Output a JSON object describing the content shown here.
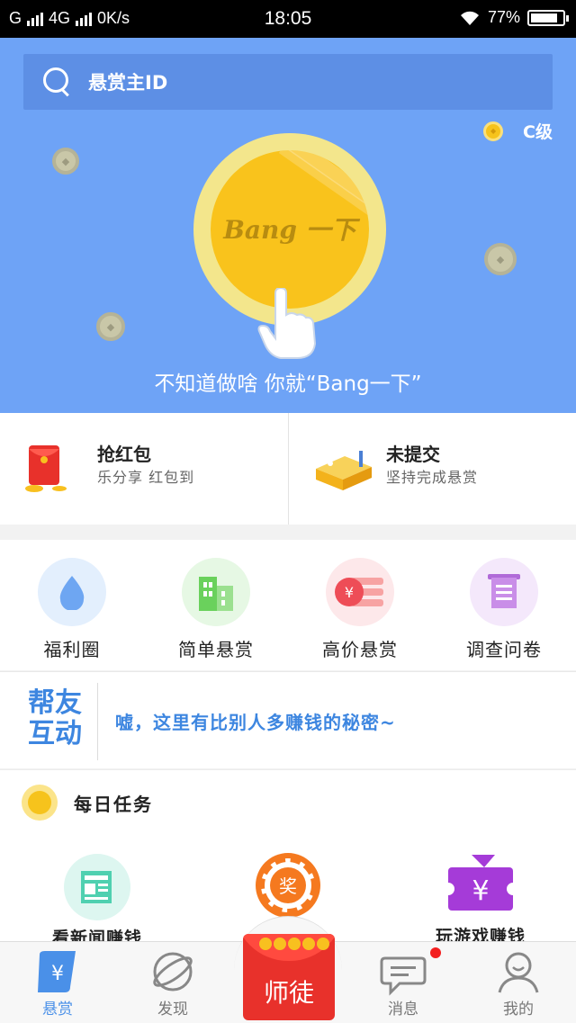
{
  "status_bar": {
    "carrier1": "G",
    "carrier2": "4G",
    "speed": "0K/s",
    "time": "18:05",
    "battery": "77%"
  },
  "hero": {
    "search_placeholder": "悬赏主ID",
    "level": "C级",
    "coin_text": "Bang 一下",
    "caption": "不知道做啥 你就“Bang一下”",
    "background_color": "#6ea3f6"
  },
  "cards": [
    {
      "title": "抢红包",
      "subtitle": "乐分享 红包到",
      "icon": "red-envelope-icon"
    },
    {
      "title": "未提交",
      "subtitle": "坚持完成悬赏",
      "icon": "tray-icon"
    }
  ],
  "categories": [
    {
      "label": "福利圈",
      "icon": "water-drop-icon",
      "color": "#e3effd"
    },
    {
      "label": "简单悬赏",
      "icon": "buildings-icon",
      "color": "#e6f8e4"
    },
    {
      "label": "高价悬赏",
      "icon": "yuan-coin-icon",
      "color": "#fde8ea"
    },
    {
      "label": "调查问卷",
      "icon": "questionnaire-icon",
      "color": "#f4e8fb"
    }
  ],
  "banner": {
    "logo_line1": "帮友",
    "logo_line2": "互动",
    "message": "嘘，这里有比别人多赚钱的秘密~"
  },
  "daily_tasks": {
    "title": "每日任务",
    "tasks": [
      {
        "label": "看新闻赚钱",
        "icon": "newspaper-icon"
      },
      {
        "label": "",
        "icon": "prize-wheel-icon",
        "badge": "奖"
      },
      {
        "label": "玩游戏赚钱",
        "icon": "game-ticket-icon"
      }
    ]
  },
  "tabbar": {
    "tabs": [
      {
        "label": "悬赏",
        "icon": "bounty-icon",
        "active": true
      },
      {
        "label": "发现",
        "icon": "planet-icon",
        "active": false
      },
      {
        "label": "消息",
        "icon": "chat-icon",
        "active": false
      },
      {
        "label": "我的",
        "icon": "profile-icon",
        "active": false
      }
    ],
    "center_label": "师徒"
  }
}
